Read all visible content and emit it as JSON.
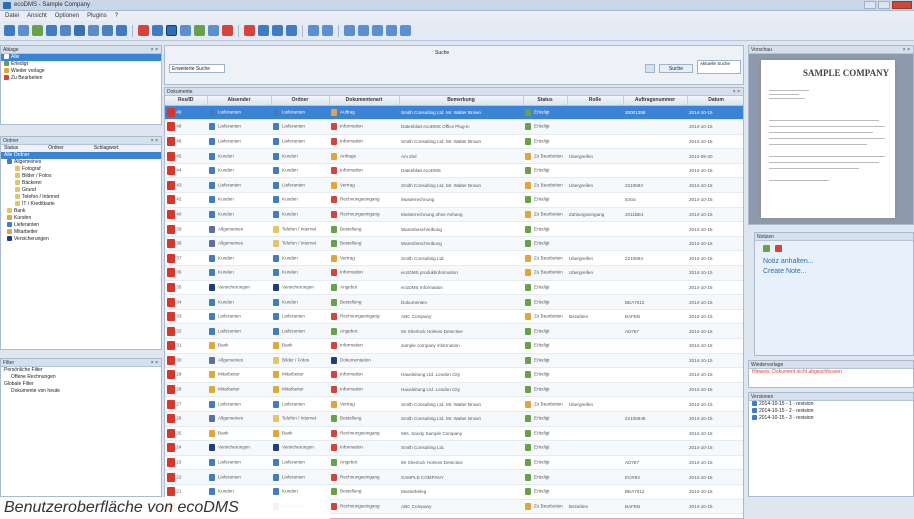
{
  "window": {
    "title": "ecoDMS - Sample Company"
  },
  "menu": [
    "Datei",
    "Ansicht",
    "Optionen",
    "Plugins",
    "?"
  ],
  "left": {
    "panel1_title": "Ablage",
    "panel1_items": [
      "Alle",
      "Erledigt",
      "Wieder vorlage",
      "Zu Bearbeiten"
    ],
    "panel2_title": "Ordner",
    "panel2_cols": [
      "Status",
      "Ordner",
      "Schlagwort"
    ],
    "tree": [
      "Alle Ordner",
      "Allgemeines",
      "Fotograf",
      "Bilder / Fotos",
      "Bäckerei",
      "Grund",
      "Telefon / Internet",
      "IT / Kreditkarte",
      "Bank",
      "Kunden",
      "Lieferanten",
      "Mitarbeiter",
      "Versicherungen"
    ],
    "panel3_title": "Filter",
    "filters": [
      "Persönliche Filter",
      "Offene Rechnungen",
      "Globale Filter",
      "Dokumente von heute"
    ]
  },
  "search": {
    "label": "Suche",
    "combo": "Erweiterte Suche",
    "button": "Suche",
    "right_combo": "Aktuelle Suche"
  },
  "grid": {
    "title": "Dokumente",
    "columns": [
      "Res/ID",
      "Absender",
      "Ordner",
      "Dokumentenart",
      "Bemerkung",
      "Status",
      "Rolle",
      "Auftragsnummer",
      "Datum"
    ],
    "rows": [
      {
        "id": "49",
        "abs": "Lieferanten",
        "ord": "Lieferanten",
        "art": "Auftrag",
        "bem": "Smith Consulting Ltd. Mr. Walter Brown",
        "st": "Erledigt",
        "rolle": "",
        "auf": "20001358",
        "dat": "2014-10-15",
        "sel": true
      },
      {
        "id": "48",
        "abs": "Lieferanten",
        "ord": "Lieferanten",
        "art": "Information",
        "bem": "Datenblatt ecoDMS Office Plug-in",
        "st": "Erledigt",
        "rolle": "",
        "auf": "",
        "dat": "2014-10-15"
      },
      {
        "id": "46",
        "abs": "Lieferanten",
        "ord": "Lieferanten",
        "art": "Information",
        "bem": "Smith Consulting Ltd. Mr. Walter Brown",
        "st": "Erledigt",
        "rolle": "",
        "auf": "",
        "dat": "2014-10-15"
      },
      {
        "id": "45",
        "abs": "Kunden",
        "ord": "Kunden",
        "art": "Anfrage",
        "bem": "Am Ziel",
        "st": "Zu Bearbeiten",
        "rolle": "Ubergreifen",
        "auf": "",
        "dat": "2014-09-30"
      },
      {
        "id": "44",
        "abs": "Kunden",
        "ord": "Kunden",
        "art": "Information",
        "bem": "Datenblatt ecoDMS",
        "st": "Erledigt",
        "rolle": "",
        "auf": "",
        "dat": "2014-10-15"
      },
      {
        "id": "43",
        "abs": "Lieferanten",
        "ord": "Lieferanten",
        "art": "Vertrag",
        "bem": "Smith Consulting Ltd. Mr. Walter Brown",
        "st": "Zu Bearbeiten",
        "rolle": "Ubergreifen",
        "auf": "2210584",
        "dat": "2014-10-15"
      },
      {
        "id": "42",
        "abs": "Kunden",
        "ord": "Kunden",
        "art": "Rechnungseingang",
        "bem": "Musterrechnung",
        "st": "Erledigt",
        "rolle": "",
        "auf": "Extra",
        "dat": "2014-10-15"
      },
      {
        "id": "40",
        "abs": "Kunden",
        "ord": "Kunden",
        "art": "Rechnungseingang",
        "bem": "Musterrechnung ohne Anhang",
        "st": "Zu Bearbeiten",
        "rolle": "Zahlungseingang",
        "auf": "2011BE4",
        "dat": "2014-10-15"
      },
      {
        "id": "39",
        "abs": "Allgemeines",
        "ord": "Telefon / Internet",
        "art": "Bestellung",
        "bem": "Warenbeschreibung",
        "st": "Erledigt",
        "rolle": "",
        "auf": "",
        "dat": "2014-10-15"
      },
      {
        "id": "38",
        "abs": "Allgemeines",
        "ord": "Telefon / Internet",
        "art": "Bestellung",
        "bem": "Warenbeschreibung",
        "st": "Erledigt",
        "rolle": "",
        "auf": "",
        "dat": "2014-10-15"
      },
      {
        "id": "37",
        "abs": "Kunden",
        "ord": "Kunden",
        "art": "Vertrag",
        "bem": "Smith Consulting Ltd.",
        "st": "Zu Bearbeiten",
        "rolle": "Ubergreifen",
        "auf": "2210584",
        "dat": "2014-10-15"
      },
      {
        "id": "36",
        "abs": "Kunden",
        "ord": "Kunden",
        "art": "Information",
        "bem": "ecoDMS produktinformation",
        "st": "Zu Bearbeiten",
        "rolle": "Ubergreifen",
        "auf": "",
        "dat": "2014-10-15"
      },
      {
        "id": "35",
        "abs": "Versicherungen",
        "ord": "Versicherungen",
        "art": "Angebot",
        "bem": "ecoDMS Information",
        "st": "Erledigt",
        "rolle": "",
        "auf": "",
        "dat": "2014-10-15"
      },
      {
        "id": "34",
        "abs": "Kunden",
        "ord": "Kunden",
        "art": "Bestellung",
        "bem": "Dokumenten",
        "st": "Erledigt",
        "rolle": "",
        "auf": "BEA7012",
        "dat": "2014-10-15"
      },
      {
        "id": "33",
        "abs": "Lieferanten",
        "ord": "Lieferanten",
        "art": "Rechnungseingang",
        "bem": "ABC Company",
        "st": "Zu Bearbeiten",
        "rolle": "Bezahlen",
        "auf": "BAFEB",
        "dat": "2014-10-15"
      },
      {
        "id": "32",
        "abs": "Lieferanten",
        "ord": "Lieferanten",
        "art": "Angebot",
        "bem": "Mr Sherlock Holmes Detective",
        "st": "Erledigt",
        "rolle": "",
        "auf": "AD787",
        "dat": "2014-10-15"
      },
      {
        "id": "31",
        "abs": "Bank",
        "ord": "Bank",
        "art": "Information",
        "bem": "sample company information",
        "st": "Erledigt",
        "rolle": "",
        "auf": "",
        "dat": "2014-10-15"
      },
      {
        "id": "30",
        "abs": "Allgemeines",
        "ord": "Bilder / Fotos",
        "art": "Dokumentation",
        "bem": "",
        "st": "Erledigt",
        "rolle": "",
        "auf": "",
        "dat": "2014-10-15"
      },
      {
        "id": "29",
        "abs": "Mitarbeiter",
        "ord": "Mitarbeiter",
        "art": "Information",
        "bem": "Hausleitung Ltd. London City",
        "st": "Erledigt",
        "rolle": "",
        "auf": "",
        "dat": "2014-10-15"
      },
      {
        "id": "28",
        "abs": "Mitarbeiter",
        "ord": "Mitarbeiter",
        "art": "Information",
        "bem": "Hausleitung Ltd. London City",
        "st": "Erledigt",
        "rolle": "",
        "auf": "",
        "dat": "2014-10-15"
      },
      {
        "id": "27",
        "abs": "Lieferanten",
        "ord": "Lieferanten",
        "art": "Vertrag",
        "bem": "Smith Consulting Ltd. Mr. Walter Brown",
        "st": "Zu Bearbeiten",
        "rolle": "Ubergreifen",
        "auf": "",
        "dat": "2014-10-15"
      },
      {
        "id": "26",
        "abs": "Allgemeines",
        "ord": "Telefon / Internet",
        "art": "Bestellung",
        "bem": "Smith Consulting Ltd. Mr. Walter Brown",
        "st": "Erledigt",
        "rolle": "",
        "auf": "22105848",
        "dat": "2014-10-15"
      },
      {
        "id": "25",
        "abs": "Bank",
        "ord": "Bank",
        "art": "Rechnungseingang",
        "bem": "Mrs. Sandy Sample Company",
        "st": "Erledigt",
        "rolle": "",
        "auf": "",
        "dat": "2014-10-15"
      },
      {
        "id": "24",
        "abs": "Versicherungen",
        "ord": "Versicherungen",
        "art": "Information",
        "bem": "Smith Consulting Ltd.",
        "st": "Erledigt",
        "rolle": "",
        "auf": "",
        "dat": "2014-10-15"
      },
      {
        "id": "23",
        "abs": "Lieferanten",
        "ord": "Lieferanten",
        "art": "Angebot",
        "bem": "Mr Sherlock Holmes Detective",
        "st": "Erledigt",
        "rolle": "",
        "auf": "AD787",
        "dat": "2014-10-15"
      },
      {
        "id": "22",
        "abs": "Lieferanten",
        "ord": "Lieferanten",
        "art": "Rechnungseingang",
        "bem": "SAMPLE COMPANY",
        "st": "Erledigt",
        "rolle": "",
        "auf": "ECR93",
        "dat": "2014-10-15"
      },
      {
        "id": "21",
        "abs": "Kunden",
        "ord": "Kunden",
        "art": "Bestellung",
        "bem": "Musterbeleg",
        "st": "Erledigt",
        "rolle": "",
        "auf": "BEA7012",
        "dat": "2014-10-15"
      },
      {
        "id": "20",
        "abs": "Lieferanten",
        "ord": "Lieferanten",
        "art": "Rechnungseingang",
        "bem": "ABC Company",
        "st": "Zu Bearbeiten",
        "rolle": "Bezahlen",
        "auf": "BAFEB",
        "dat": "2014-10-15"
      }
    ]
  },
  "right": {
    "preview_title": "Vorschau",
    "company": "SAMPLE COMPANY",
    "notes_title": "Notizen",
    "notes_text1": "Notiz anhalten...",
    "notes_text2": "Create Note...",
    "workflow_title": "Wiedervorlage",
    "workflow_warn": "Hinweis: Dokument nicht abgeschlossen",
    "versions_title": "Versionen",
    "versions": [
      "2014-10-15 - 1 - revision",
      "2014-10-15 - 2 - revision",
      "2014-10-15 - 3 - revision"
    ]
  },
  "caption": "Benutzeroberfläche von ecoDMS",
  "colors": {
    "selection": "#3b83d6",
    "pdf": "#d9362b",
    "accent": "#2f6db3"
  }
}
